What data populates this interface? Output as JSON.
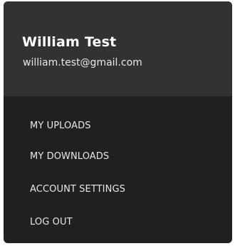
{
  "user": {
    "name": "William Test",
    "email": "william.test@gmail.com"
  },
  "menu": {
    "items": [
      {
        "label": "MY UPLOADS"
      },
      {
        "label": "MY DOWNLOADS"
      },
      {
        "label": "ACCOUNT SETTINGS"
      },
      {
        "label": "LOG OUT"
      }
    ]
  },
  "colors": {
    "panel_background": "#202022",
    "header_background": "#323235",
    "text": "#ffffff"
  }
}
